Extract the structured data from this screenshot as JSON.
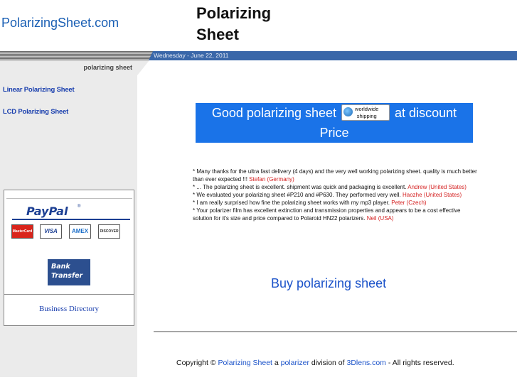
{
  "header": {
    "site_name": "PolarizingSheet.com",
    "page_title": "Polarizing Sheet",
    "date": "Wednesday - June 22, 2011"
  },
  "sidebar": {
    "heading": "polarizing sheet",
    "links": [
      "Linear Polarizing Sheet",
      "LCD Polarizing Sheet"
    ],
    "payment": {
      "paypal": "PayPal",
      "paypal_mark": "®",
      "cards": [
        "MasterCard",
        "VISA",
        "AMEX",
        "DISCOVER"
      ],
      "bank_line1": "Bank",
      "bank_line2": "Transfer"
    },
    "business_directory": "Business Directory"
  },
  "promo": {
    "before": "Good polarizing sheet",
    "badge_line1": "worldwide",
    "badge_line2": "shipping",
    "after": "at discount Price"
  },
  "testimonials": [
    {
      "text": "* Many thanks for the ultra fast delivery (4 days) and the very well working polarizing sheet. quality is much better than ever expected !!! ",
      "who": "Stefan (Germany)"
    },
    {
      "text": "* ... The polarizing sheet is excellent. shipment was quick and packaging is excellent. ",
      "who": "Andrew (United States)"
    },
    {
      "text": "* We evaluated your polarizing sheet #P210 and #P630. They performed very well. ",
      "who": "Haozhe (United States)"
    },
    {
      "text": "* I am really surprised how fine the polarizing sheet works with my mp3 player. ",
      "who": "Peter (Czech)"
    },
    {
      "text": "* Your polarizer film has excellent extinction and transmission properties and appears to be a cost effective solution for it's size and price compared to Polaroid HN22 polarizers. ",
      "who": "Neil (USA)"
    }
  ],
  "buy_link": "Buy polarizing sheet",
  "footer": {
    "prefix": "Copyright © ",
    "link1": "Polarizing Sheet",
    "mid1": " a ",
    "link2": "polarizer",
    "mid2": " division of ",
    "link3": "3Dlens.com",
    "suffix": " - All rights reserved."
  },
  "colors": {
    "link_blue": "#1a3fae",
    "promo_blue": "#1a73e8",
    "header_blue": "#3a67a9",
    "author_red": "#d42020"
  }
}
